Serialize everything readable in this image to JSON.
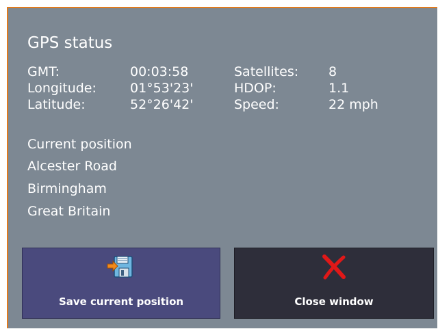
{
  "title": "GPS status",
  "status": {
    "gmt_label": "GMT:",
    "gmt_value": "00:03:58",
    "satellites_label": "Satellites:",
    "satellites_value": "8",
    "longitude_label": "Longitude:",
    "longitude_value": "01°53'23'",
    "hdop_label": "HDOP:",
    "hdop_value": "1.1",
    "latitude_label": "Latitude:",
    "latitude_value": "52°26'42'",
    "speed_label": "Speed:",
    "speed_value": "22 mph"
  },
  "position": {
    "heading": "Current position",
    "street": "Alcester Road",
    "city": "Birmingham",
    "country": "Great Britain"
  },
  "buttons": {
    "save_label": "Save current position",
    "save_icon": "save-floppy-icon",
    "close_label": "Close window",
    "close_icon": "close-x-icon"
  },
  "colors": {
    "window_bg": "#7d8893",
    "border_accent": "#e07a1e",
    "save_button_bg": "#4a4a7d",
    "close_button_bg": "#2e2e3a",
    "close_icon_red": "#e01818"
  }
}
